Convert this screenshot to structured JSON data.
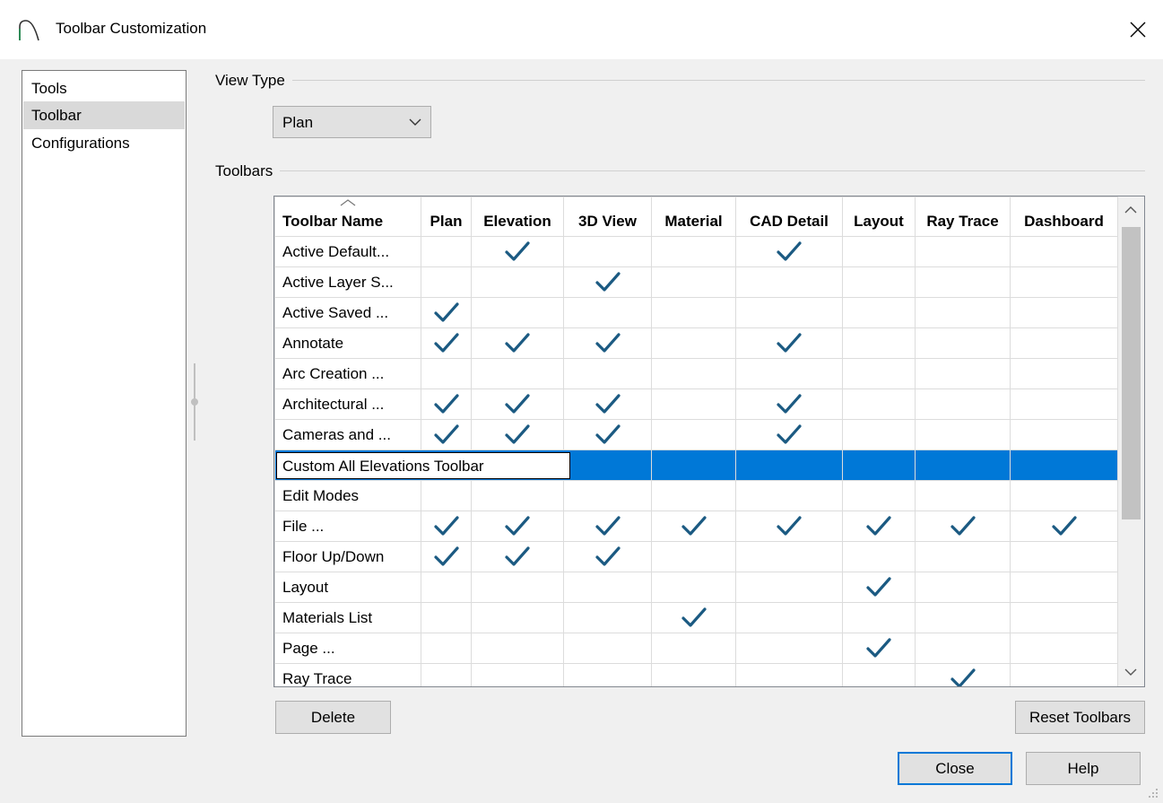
{
  "window": {
    "title": "Toolbar Customization"
  },
  "nav": {
    "items": [
      "Tools",
      "Toolbar",
      "Configurations"
    ],
    "selected_index": 1
  },
  "view_type": {
    "label": "View Type",
    "value": "Plan"
  },
  "toolbars_group": {
    "label": "Toolbars"
  },
  "grid": {
    "columns": [
      "Toolbar Name",
      "Plan",
      "Elevation",
      "3D View",
      "Material",
      "CAD Detail",
      "Layout",
      "Ray Trace",
      "Dashboard"
    ],
    "rows": [
      {
        "name": "Active Default...",
        "checks": [
          false,
          true,
          false,
          false,
          true,
          false,
          false,
          false
        ]
      },
      {
        "name": "Active Layer S...",
        "checks": [
          false,
          false,
          true,
          false,
          false,
          false,
          false,
          false
        ]
      },
      {
        "name": "Active Saved ...",
        "checks": [
          true,
          false,
          false,
          false,
          false,
          false,
          false,
          false
        ]
      },
      {
        "name": "Annotate",
        "checks": [
          true,
          true,
          true,
          false,
          true,
          false,
          false,
          false
        ]
      },
      {
        "name": "Arc Creation ...",
        "checks": [
          false,
          false,
          false,
          false,
          false,
          false,
          false,
          false
        ]
      },
      {
        "name": "Architectural ...",
        "checks": [
          true,
          true,
          true,
          false,
          true,
          false,
          false,
          false
        ]
      },
      {
        "name": "Cameras and ...",
        "checks": [
          true,
          true,
          true,
          false,
          true,
          false,
          false,
          false
        ]
      },
      {
        "name": "Custom All Elevations Toolbar",
        "checks": [
          false,
          false,
          false,
          false,
          false,
          false,
          false,
          false
        ],
        "selected": true,
        "editing": true
      },
      {
        "name": "Edit Modes",
        "checks": [
          false,
          false,
          false,
          false,
          false,
          false,
          false,
          false
        ]
      },
      {
        "name": "File ...",
        "checks": [
          true,
          true,
          true,
          true,
          true,
          true,
          true,
          true
        ]
      },
      {
        "name": "Floor Up/Down",
        "checks": [
          true,
          true,
          true,
          false,
          false,
          false,
          false,
          false
        ]
      },
      {
        "name": "Layout",
        "checks": [
          false,
          false,
          false,
          false,
          false,
          true,
          false,
          false
        ]
      },
      {
        "name": "Materials List",
        "checks": [
          false,
          false,
          false,
          true,
          false,
          false,
          false,
          false
        ]
      },
      {
        "name": "Page ...",
        "checks": [
          false,
          false,
          false,
          false,
          false,
          true,
          false,
          false
        ]
      },
      {
        "name": "Ray Trace",
        "checks": [
          false,
          false,
          false,
          false,
          false,
          false,
          true,
          false
        ]
      }
    ]
  },
  "buttons": {
    "delete": "Delete",
    "reset": "Reset Toolbars",
    "close": "Close",
    "help": "Help"
  },
  "colors": {
    "check": "#1b5a82",
    "selection": "#0078d7",
    "primary_border": "#0078d7"
  }
}
